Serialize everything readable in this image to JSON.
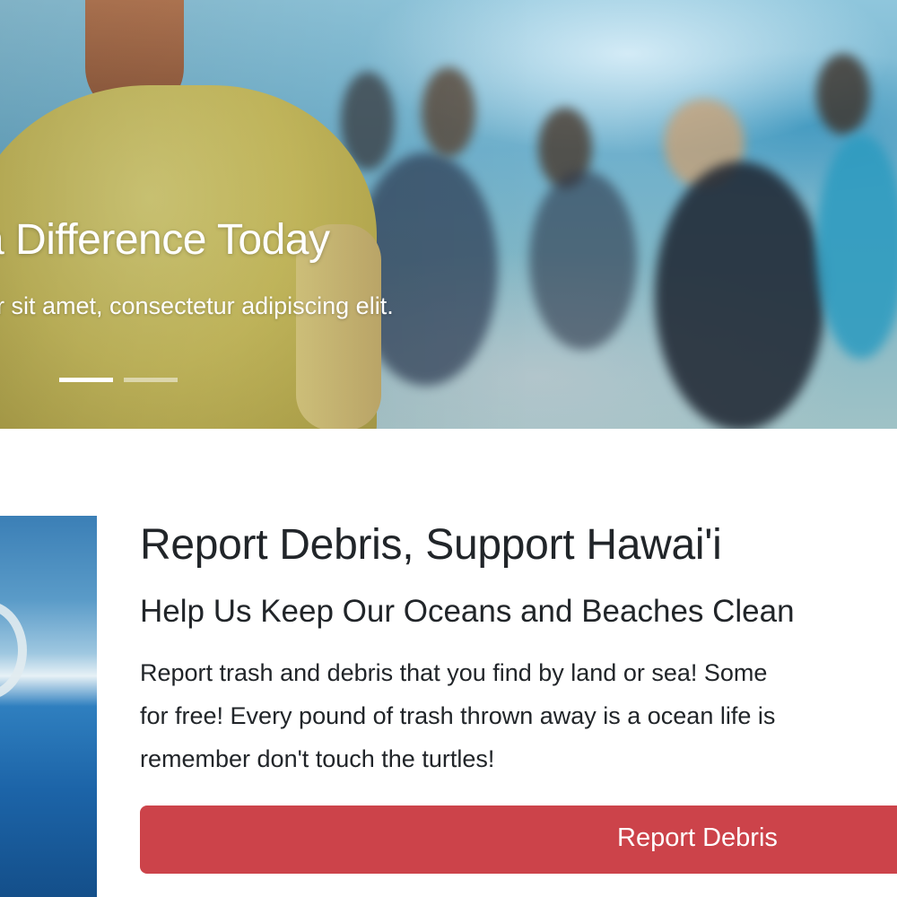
{
  "hero": {
    "title": "a Difference Today",
    "text": "r sit amet, consectetur adipiscing elit.",
    "indicators": [
      {
        "label": "Slide 1",
        "active": true
      },
      {
        "label": "Slide 2",
        "active": false
      }
    ]
  },
  "feature": {
    "title": "Report Debris, Support Hawai'i",
    "subtitle": "Help Us Keep Our Oceans and Beaches Clean",
    "body_lines": [
      "Report trash and debris that you find by land or sea! Some",
      "for free! Every pound of trash thrown away is a ocean life is",
      "remember don't touch the turtles!"
    ],
    "button_label": "Report Debris"
  },
  "colors": {
    "button": "#cc434a",
    "text": "#212529",
    "indicator": "#ffffff"
  }
}
